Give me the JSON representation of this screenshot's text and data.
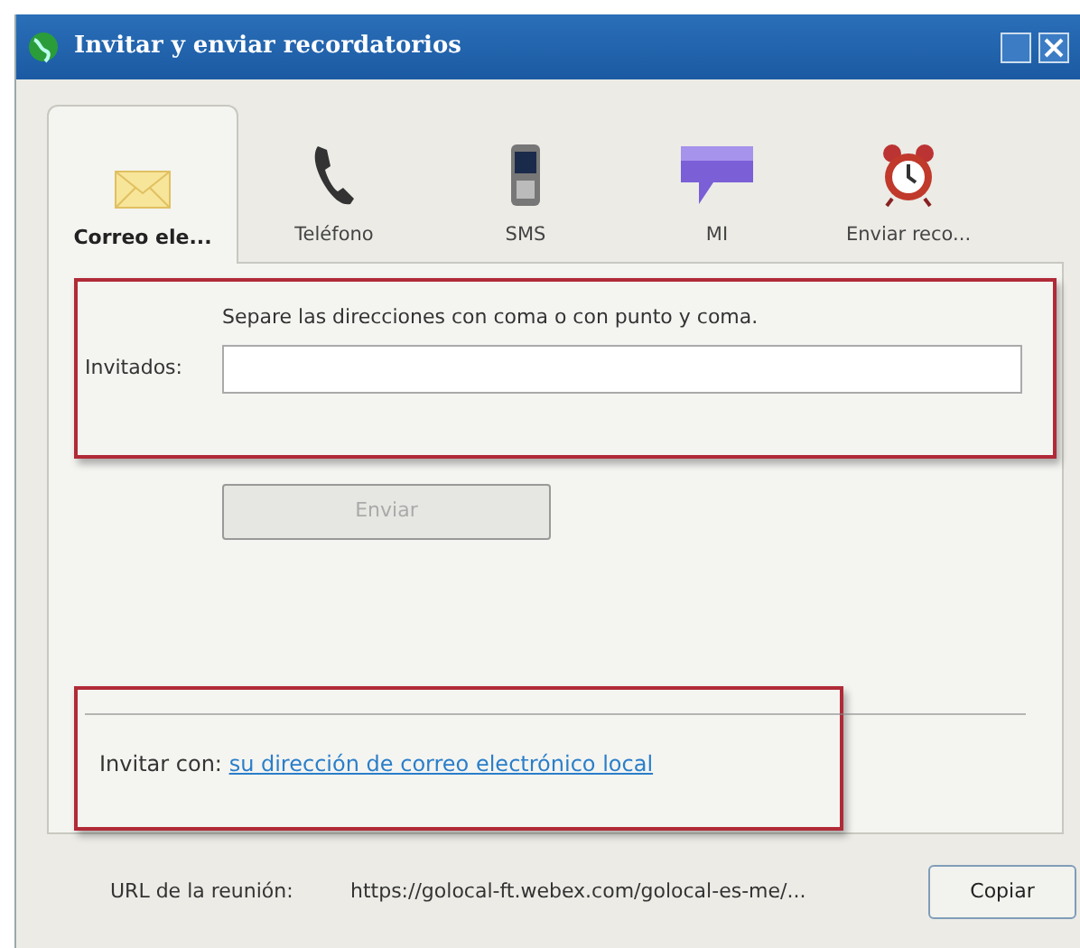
{
  "window": {
    "title": "Invitar y enviar recordatorios"
  },
  "tabs": [
    {
      "label": "Correo ele...",
      "kind": "mail",
      "selected": true
    },
    {
      "label": "Teléfono",
      "kind": "phone",
      "selected": false
    },
    {
      "label": "SMS",
      "kind": "mobile",
      "selected": false
    },
    {
      "label": "MI",
      "kind": "chat",
      "selected": false
    },
    {
      "label": "Enviar reco...",
      "kind": "clock",
      "selected": false
    }
  ],
  "form": {
    "hint": "Separe las direcciones con coma o con punto y coma.",
    "label": "Invitados:",
    "send_button": {
      "label": "Enviar",
      "disabled": true
    }
  },
  "invite_with": {
    "label": "Invitar con:",
    "link": "su dirección de correo electrónico local"
  },
  "footer": {
    "label": "URL de la reunión:",
    "url": "https://golocal-ft.webex.com/golocal-es-me/...",
    "copy_button": "Copiar"
  }
}
